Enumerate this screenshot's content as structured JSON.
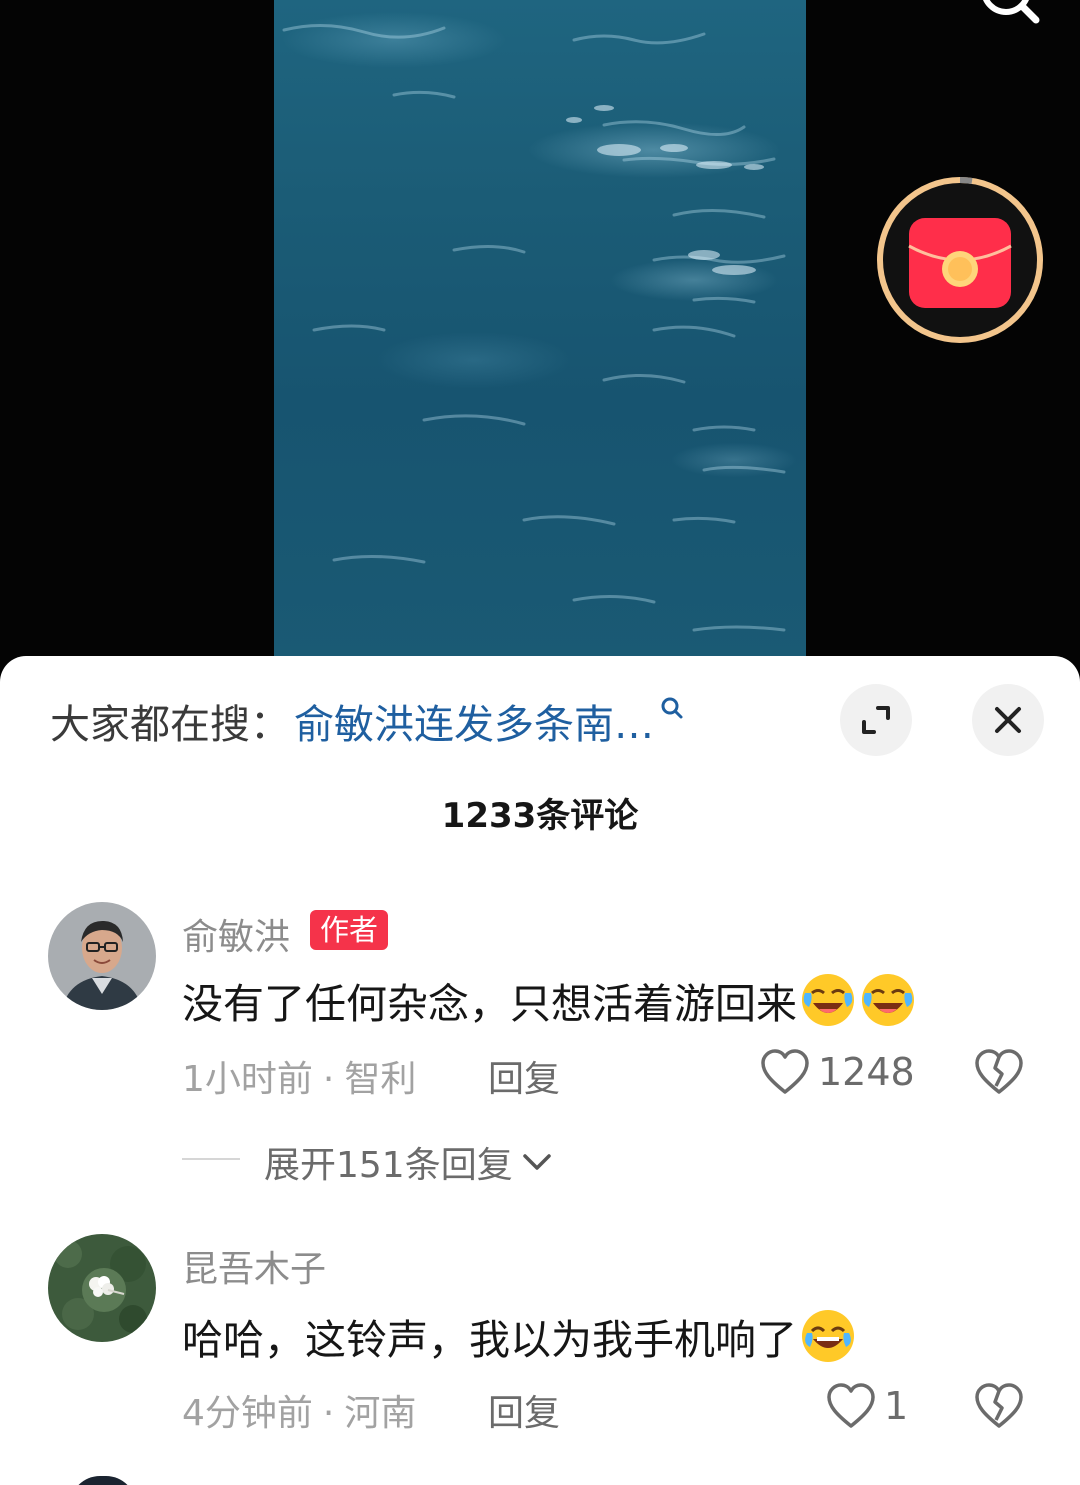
{
  "search_hint": {
    "prefix": "大家都在搜：",
    "query": "俞敏洪连发多条南…"
  },
  "comment_count_label": "1233条评论",
  "comments": [
    {
      "name": "俞敏洪",
      "badge": "作者",
      "text": "没有了任何杂念，只想活着游回来",
      "emojis": [
        "crying-laughing-emoji",
        "crying-laughing-emoji"
      ],
      "time": "1小时前",
      "location": "智利",
      "reply_label": "回复",
      "likes": "1248",
      "expand_label": "展开151条回复"
    },
    {
      "name": "昆吾木子",
      "text": "哈哈，这铃声，我以为我手机响了",
      "emojis": [
        "tears-of-joy-emoji"
      ],
      "time": "4分钟前",
      "location": "河南",
      "reply_label": "回复",
      "likes": "1"
    }
  ],
  "colors": {
    "accent_link": "#1f5fa0",
    "author_badge": "#f5334a",
    "sea": "#1b5c76"
  },
  "icons": [
    "search-icon",
    "red-packet-icon",
    "magnifier-icon",
    "expand-icon",
    "close-icon",
    "heart-icon",
    "broken-heart-icon",
    "chevron-down-icon"
  ]
}
